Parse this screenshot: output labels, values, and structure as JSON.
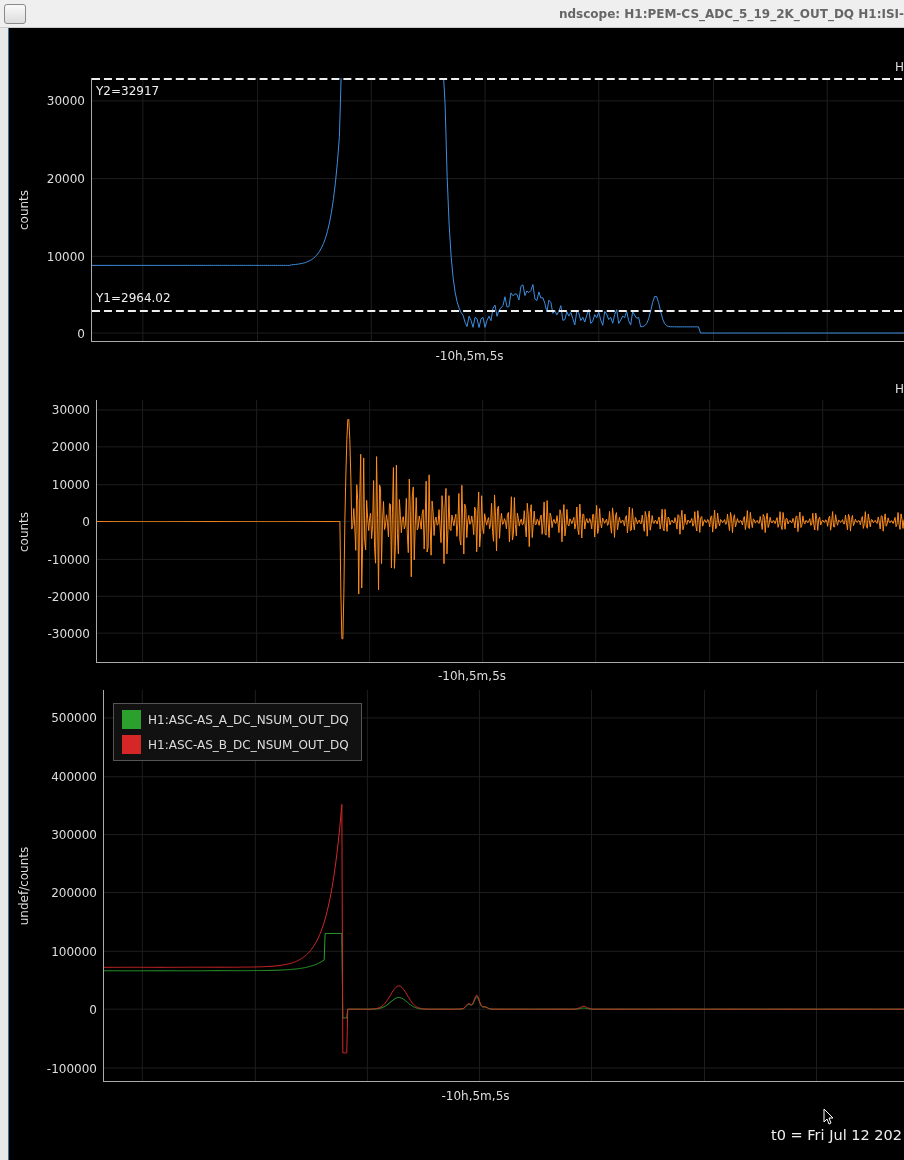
{
  "window": {
    "title": "ndscope: H1:PEM-CS_ADC_5_19_2K_OUT_DQ H1:ISI-"
  },
  "plots": [
    {
      "kind": "spectrum",
      "title": "H",
      "ylabel": "counts",
      "yticks": [
        "30000",
        "20000",
        "10000",
        "0"
      ],
      "xlabel": "-10h,5m,5s",
      "cursors": [
        {
          "label": "Y2=32917"
        },
        {
          "label": "Y1=2964.02"
        }
      ]
    },
    {
      "kind": "seismic",
      "title": "H",
      "ylabel": "counts",
      "yticks": [
        "30000",
        "20000",
        "10000",
        "0",
        "-10000",
        "-20000",
        "-30000"
      ],
      "xlabel": "-10h,5m,5s"
    },
    {
      "kind": "sum",
      "ylabel": "undef/counts",
      "yticks": [
        "500000",
        "400000",
        "300000",
        "200000",
        "100000",
        "0",
        "-100000"
      ],
      "xlabel": "-10h,5m,5s",
      "legend": [
        {
          "label": "H1:ASC-AS_A_DC_NSUM_OUT_DQ",
          "color": "#2ca02c"
        },
        {
          "label": "H1:ASC-AS_B_DC_NSUM_OUT_DQ",
          "color": "#d62728"
        }
      ]
    }
  ],
  "footer": {
    "t0": "t0 = Fri Jul 12 202"
  }
}
